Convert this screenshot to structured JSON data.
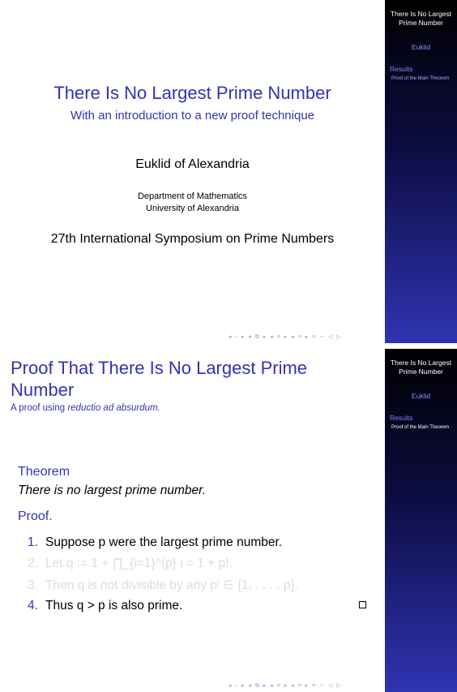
{
  "sidebar": {
    "title": "There Is No Largest Prime Number",
    "author": "Euklid",
    "section": "Results",
    "subsection": "Proof of the Main Theorem"
  },
  "slide1": {
    "title": "There Is No Largest Prime Number",
    "subtitle": "With an introduction to a new proof technique",
    "author": "Euklid of Alexandria",
    "institute_line1": "Department of Mathematics",
    "institute_line2": "University of Alexandria",
    "conference": "27th International Symposium on Prime Numbers"
  },
  "slide2": {
    "frame_title": "Proof That There Is No Largest Prime Number",
    "frame_subtitle_prefix": "A proof using ",
    "frame_subtitle_emph": "reductio ad absurdum.",
    "theorem_heading": "Theorem",
    "theorem_body": "There is no largest prime number.",
    "proof_heading": "Proof.",
    "steps": [
      {
        "num": "1.",
        "text": "Suppose p were the largest prime number."
      },
      {
        "num": "2.",
        "text": "Let q := 1 + ∏_{i=1}^{p} i = 1 + p!."
      },
      {
        "num": "3.",
        "text": "Then q is not divisible by any p′ ∈ {1, . . . , p}."
      },
      {
        "num": "4.",
        "text": "Thus q > p is also prime."
      }
    ]
  },
  "nav_symbols": "◂ ▫ ▸ ◂ ⧉ ▸ ◂ ≡ ▸ ◂ ≡ ▸   ≡   ∽ ◁ ▷"
}
